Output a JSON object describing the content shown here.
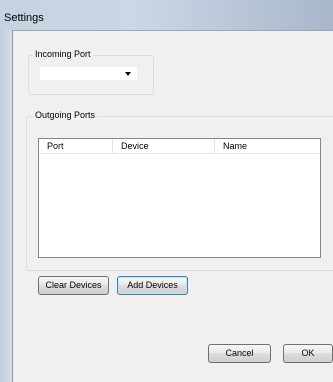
{
  "window": {
    "title": "Settings"
  },
  "incoming": {
    "group_label": "Incoming Port",
    "selected_value": ""
  },
  "outgoing": {
    "group_label": "Outgoing Ports",
    "columns": [
      "Port",
      "Device",
      "Name"
    ],
    "rows": []
  },
  "buttons": {
    "clear_devices": "Clear Devices",
    "add_devices": "Add Devices",
    "cancel": "Cancel",
    "ok": "OK"
  },
  "icons": {
    "dropdown": "chevron-down-icon"
  }
}
